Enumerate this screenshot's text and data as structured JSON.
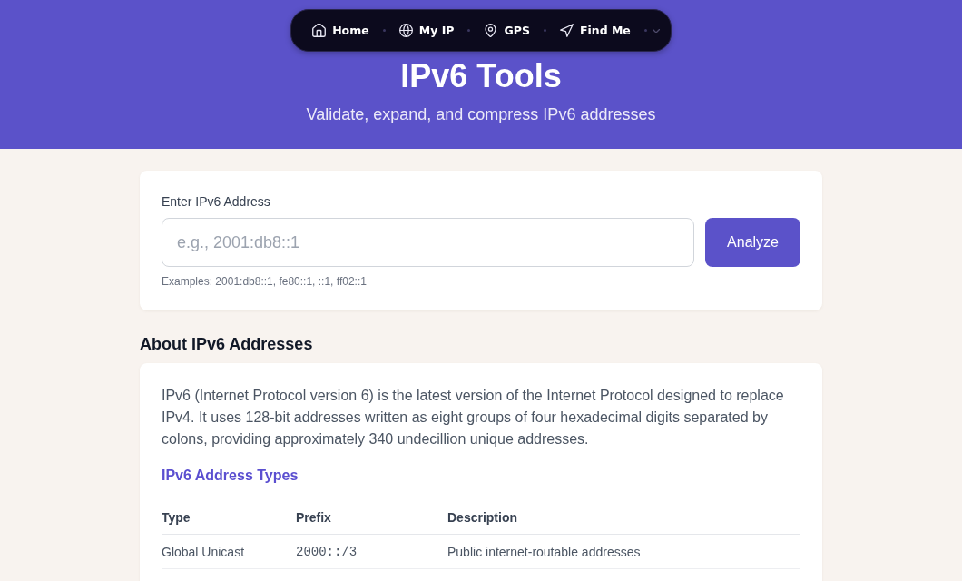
{
  "nav": {
    "items": [
      {
        "kind": "home",
        "label": "Home"
      },
      {
        "kind": "globe",
        "label": "My IP"
      },
      {
        "kind": "pin",
        "label": "GPS"
      },
      {
        "kind": "navigate",
        "label": "Find Me"
      }
    ]
  },
  "header": {
    "title": "IPv6 Tools",
    "subtitle": "Validate, expand, and compress IPv6 addresses"
  },
  "lookup": {
    "label": "Enter IPv6 Address",
    "placeholder": "e.g., 2001:db8::1",
    "button": "Analyze",
    "examples": "Examples: 2001:db8::1, fe80::1, ::1, ff02::1"
  },
  "about": {
    "heading": "About IPv6 Addresses",
    "paragraph": "IPv6 (Internet Protocol version 6) is the latest version of the Internet Protocol designed to replace IPv4. It uses 128-bit addresses written as eight groups of four hexadecimal digits separated by colons, providing approximately 340 undecillion unique addresses.",
    "subheading": "IPv6 Address Types",
    "table": {
      "columns": [
        "Type",
        "Prefix",
        "Description"
      ],
      "rows": [
        {
          "type": "Global Unicast",
          "prefix": "2000::/3",
          "description": "Public internet-routable addresses"
        }
      ]
    }
  }
}
